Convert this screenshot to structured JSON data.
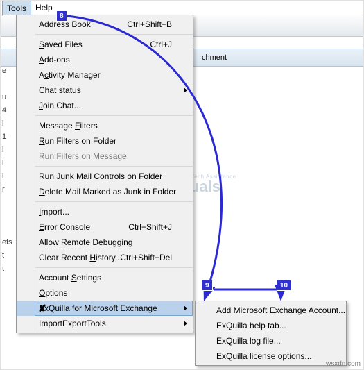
{
  "menubar": {
    "tools": "Tools",
    "help": "Help"
  },
  "panel": {
    "attachment": "chment"
  },
  "left_strip": [
    "e",
    "",
    "u",
    "4",
    "l",
    "1",
    "l",
    "l",
    "l",
    "r",
    "",
    "",
    "",
    "ets",
    "t",
    "t"
  ],
  "menu": {
    "rows": [
      {
        "kind": "item",
        "label": "Address Book",
        "shortcut": "Ctrl+Shift+B",
        "u": 0
      },
      {
        "kind": "sep"
      },
      {
        "kind": "item",
        "label": "Saved Files",
        "shortcut": "Ctrl+J",
        "u": 0
      },
      {
        "kind": "item",
        "label": "Add-ons",
        "u": 0
      },
      {
        "kind": "item",
        "label": "Activity Manager",
        "u": 1
      },
      {
        "kind": "item",
        "label": "Chat status",
        "u": 0,
        "sub": true
      },
      {
        "kind": "item",
        "label": "Join Chat...",
        "u": 0
      },
      {
        "kind": "sep"
      },
      {
        "kind": "item",
        "label": "Message Filters",
        "u": 8
      },
      {
        "kind": "item",
        "label": "Run Filters on Folder",
        "u": 0
      },
      {
        "kind": "item",
        "label": "Run Filters on Message",
        "u": 22,
        "disabled": true
      },
      {
        "kind": "sep"
      },
      {
        "kind": "item",
        "label": "Run Junk Mail Controls on Folder",
        "u": 32
      },
      {
        "kind": "item",
        "label": "Delete Mail Marked as Junk in Folder",
        "u": 0
      },
      {
        "kind": "sep"
      },
      {
        "kind": "item",
        "label": "Import...",
        "u": 0
      },
      {
        "kind": "item",
        "label": "Error Console",
        "shortcut": "Ctrl+Shift+J",
        "u": 0
      },
      {
        "kind": "item",
        "label": "Allow Remote Debugging",
        "u": 6
      },
      {
        "kind": "item",
        "label": "Clear Recent History...",
        "shortcut": "Ctrl+Shift+Del",
        "u": 13
      },
      {
        "kind": "sep"
      },
      {
        "kind": "item",
        "label": "Account Settings",
        "u": 8
      },
      {
        "kind": "item",
        "label": "Options",
        "u": 0
      },
      {
        "kind": "item",
        "label": "ExQuilla for Microsoft Exchange",
        "sub": true,
        "hl": true,
        "icon": true
      },
      {
        "kind": "item",
        "label": "ImportExportTools",
        "sub": true
      }
    ]
  },
  "submenu": {
    "rows": [
      {
        "label": "Add Microsoft Exchange Account..."
      },
      {
        "label": "ExQuilla help tab..."
      },
      {
        "label": "ExQuilla log file..."
      },
      {
        "label": "ExQuilla license options..."
      }
    ]
  },
  "callouts": {
    "a": "8",
    "b": "9",
    "c": "10"
  },
  "watermark": {
    "big": "ppuals",
    "small": "Expert Tech Assistance"
  },
  "credit": "wsxdn.com"
}
